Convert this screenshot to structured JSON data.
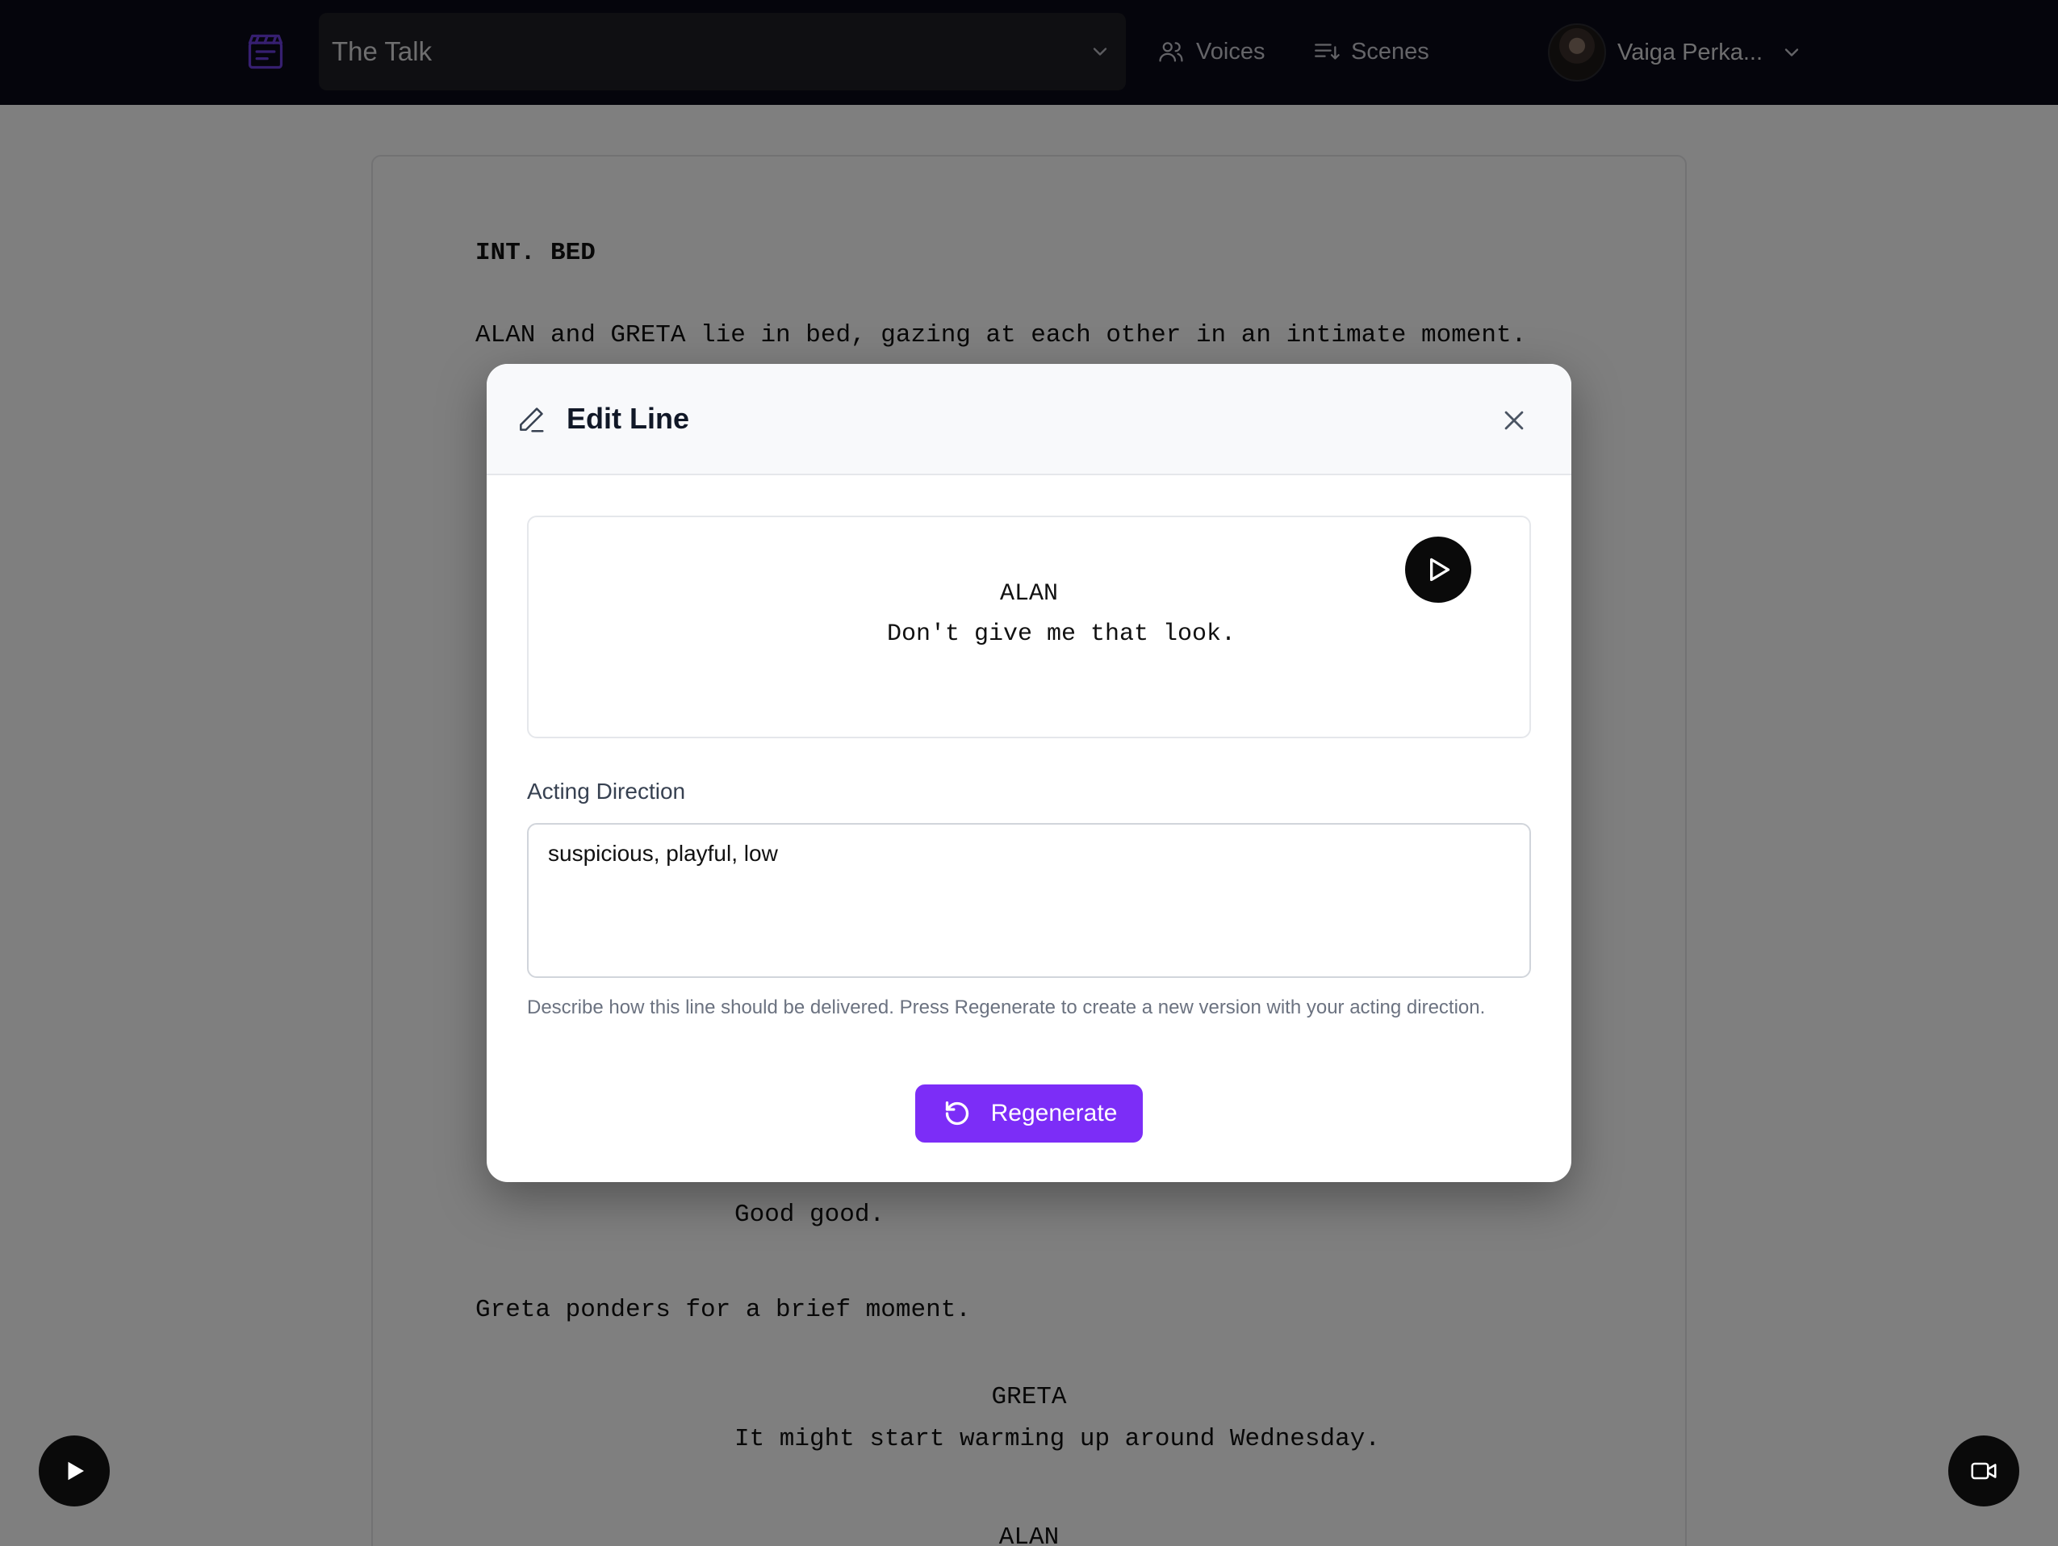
{
  "nav": {
    "logo_icon": "clapperboard-icon",
    "project_name": "The Talk",
    "voices_label": "Voices",
    "scenes_label": "Scenes",
    "user_name": "Vaiga Perka..."
  },
  "script": {
    "scene_heading": "INT. BED",
    "action_1": "ALAN and GRETA lie in bed, gazing at each other in an intimate moment.",
    "dialog_partial": "Good good.",
    "action_2": "Greta ponders for a brief moment.",
    "character_greta": "GRETA",
    "dialog_greta": "It might start warming up around Wednesday.",
    "character_alan_2": "ALAN"
  },
  "modal": {
    "title": "Edit Line",
    "line_character": "ALAN",
    "line_text": "Don't give me that look.",
    "acting_direction_label": "Acting Direction",
    "acting_direction_value": "suspicious, playful, low",
    "help_text": "Describe how this line should be delivered. Press Regenerate to create a new version with your acting direction.",
    "regenerate_label": "Regenerate"
  },
  "colors": {
    "accent": "#7c2df7",
    "topbar": "#0b0a18",
    "logo": "#6d3fe0"
  }
}
